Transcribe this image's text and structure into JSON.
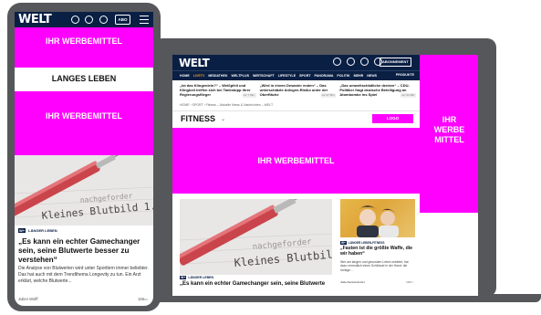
{
  "colors": {
    "brand_navy": "#0a1f44",
    "ad_magenta": "#ff00ff",
    "device_gray": "#56575b",
    "nav_highlight": "#f29c38"
  },
  "desktop": {
    "logo": "WELT",
    "abo_label": "ABONNEMENT",
    "nav": {
      "items": [
        "HOME",
        "LIVETV",
        "MEDIATHEK",
        "WELTPLUS",
        "WIRTSCHAFT",
        "LIFESTYLE",
        "SPORT",
        "PANORAMA",
        "POLITIK",
        "MEHR",
        "NEWS"
      ],
      "highlight": "LIVETV",
      "products_label": "PRODUKTE"
    },
    "ticker": [
      {
        "text": "„Ist das Klingenlein?“ – Weißpfeil und Klingbeil treffen sich bei Tankstopp ihrer Regierungsflieger",
        "time": "vor 7 Min."
      },
      {
        "text": "„Wird in einem Desaster enden“ – Das unterschätzte Anlegen-Risiko unter der Oberfläche",
        "time": "vor 27 Min."
      },
      {
        "text": "„Das umweltschädliche denken“ – CDU-Politiker fragt deutsche Beteiligung an Atombombe ins Spiel",
        "time": "vor 31 Min."
      }
    ],
    "breadcrumb": "HOME  ›  SPORT  ›  Fitness – Aktuelle News & Nachrichten – WELT",
    "ressort_title": "FITNESS",
    "logo_box": "LOGO",
    "ad_main": "IHR WERBEMITTEL",
    "ad_right_lines": [
      "IHR",
      "WERBE",
      "MITTEL"
    ],
    "article": {
      "tag_badge": "W+",
      "tag": "LÄNGER LEBEN",
      "title": "„Es kann ein echter Gamechanger sein, seine Blutwerte"
    },
    "side_article": {
      "tag_badge": "W+",
      "tag": "LÄNGER LEBEN-FITNESS",
      "title": "„Fasten ist die größte Waffe, die wir haben“",
      "text": "Wer am langen und gesunden Leben arbeitet, hat dazu vermutlich einen Schlüssel in der Hand: die richtige...",
      "author": "Julia Reckendorfer",
      "comments": "166"
    }
  },
  "mobile": {
    "logo": "WELT",
    "abo_label": "ABO",
    "ad_top": "IHR WERBEMITTEL",
    "section": "LANGES LEBEN",
    "ad_mid": "IHR WERBEMITTEL",
    "image_label": "Kleines Blutbild 1.",
    "article": {
      "tag_badge": "W+",
      "tag": "LÄNGER LEBEN",
      "title": "„Es kann ein echter Gamechanger sein, seine Blutwerte besser zu verstehen“",
      "text": "Die Analyse von Blutwerten wird unter Sportlern immer beliebter. Das hat auch mit dem Trendthema Longevity zu tun. Ein Arzt erklärt, welche Blutwerte...",
      "author": "Julien Wolff",
      "comments": "166"
    }
  }
}
